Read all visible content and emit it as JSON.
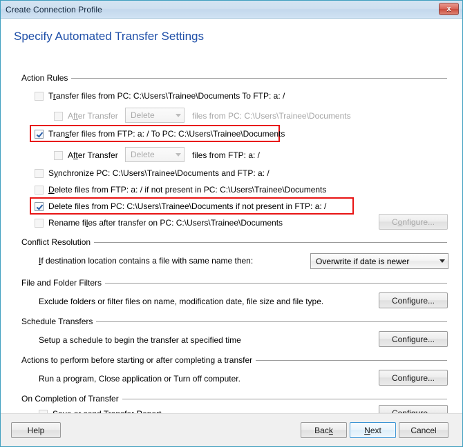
{
  "window": {
    "title": "Create Connection Profile",
    "close_label": "x"
  },
  "page": {
    "heading": "Specify Automated Transfer Settings"
  },
  "groups": {
    "action_rules": "Action Rules",
    "conflict_resolution": "Conflict Resolution",
    "file_folder_filters": "File and Folder Filters",
    "schedule_transfers": "Schedule Transfers",
    "actions_before_after": "Actions to perform before starting or after completing a transfer",
    "on_completion": "On Completion of Transfer"
  },
  "action_rules": {
    "rule1": {
      "label_pre": "T",
      "label_acc": "r",
      "label_post": "ansfer files from PC: C:\\Users\\Trainee\\Documents  To  FTP: a: /",
      "checked": false,
      "highlighted": false
    },
    "rule1_after": {
      "label_pre": "A",
      "label_acc": "ft",
      "label_post": "er Transfer",
      "checked": false,
      "enabled": false,
      "combo_value": "Delete",
      "suffix": "files from PC: C:\\Users\\Trainee\\Documents"
    },
    "rule2": {
      "label_pre": "Tran",
      "label_acc": "s",
      "label_post": "fer files from FTP: a: /  To  PC: C:\\Users\\Trainee\\Documents",
      "checked": true,
      "highlighted": true
    },
    "rule2_after": {
      "label_pre": "A",
      "label_acc": "ft",
      "label_post": "er Transfer",
      "checked": false,
      "enabled": false,
      "combo_value": "Delete",
      "suffix": "files from FTP: a: /"
    },
    "rule3": {
      "label_pre": "S",
      "label_acc": "y",
      "label_post": "nchronize PC: C:\\Users\\Trainee\\Documents and FTP: a: /",
      "checked": false,
      "highlighted": false
    },
    "rule4": {
      "label_pre": "",
      "label_acc": "D",
      "label_post": "elete files from FTP: a: / if not present in PC: C:\\Users\\Trainee\\Documents",
      "checked": false,
      "highlighted": false
    },
    "rule5": {
      "label_pre": "",
      "label_acc": "",
      "label_post": "Delete files from PC: C:\\Users\\Trainee\\Documents if not present in FTP: a: /",
      "checked": true,
      "highlighted": true
    },
    "rule6": {
      "label_pre": "Rename fi",
      "label_acc": "l",
      "label_post": "es after transfer on PC: C:\\Users\\Trainee\\Documents",
      "checked": false,
      "highlighted": false,
      "configure_label_pre": "C",
      "configure_label_acc": "o",
      "configure_label_post": "nfigure...",
      "configure_enabled": false
    }
  },
  "conflict_resolution": {
    "label_pre": "",
    "label_acc": "I",
    "label_post": "f destination location contains a file with same name then:",
    "selected": "Overwrite if date is newer",
    "options": [
      "Overwrite if date is newer"
    ]
  },
  "file_folder_filters": {
    "description": "Exclude folders or filter files on name, modification date, file size and file type.",
    "configure_pre": "Confi",
    "configure_acc": "g",
    "configure_post": "ure..."
  },
  "schedule_transfers": {
    "description": "Setup a schedule to begin the transfer at specified time",
    "configure_pre": "Confi",
    "configure_acc": "g",
    "configure_post": "ure..."
  },
  "actions_before_after": {
    "description": "Run a program, Close application or Turn off computer.",
    "configure_pre": "Confi",
    "configure_acc": "g",
    "configure_post": "ure..."
  },
  "on_completion": {
    "label_pre": "Sa",
    "label_acc": "v",
    "label_post": "e or send Transfer Report",
    "checked": false,
    "configure_pre": "Confi",
    "configure_acc": "g",
    "configure_post": "ure..."
  },
  "footer": {
    "help": "Help",
    "back_pre": "Bac",
    "back_acc": "k",
    "back_post": "",
    "next_pre": "",
    "next_acc": "N",
    "next_post": "ext",
    "cancel": "Cancel"
  },
  "colors": {
    "heading": "#1f4fa8",
    "highlight": "#e81313",
    "window_border": "#3f9fbf",
    "default_button_focus": "#3c94d4"
  }
}
